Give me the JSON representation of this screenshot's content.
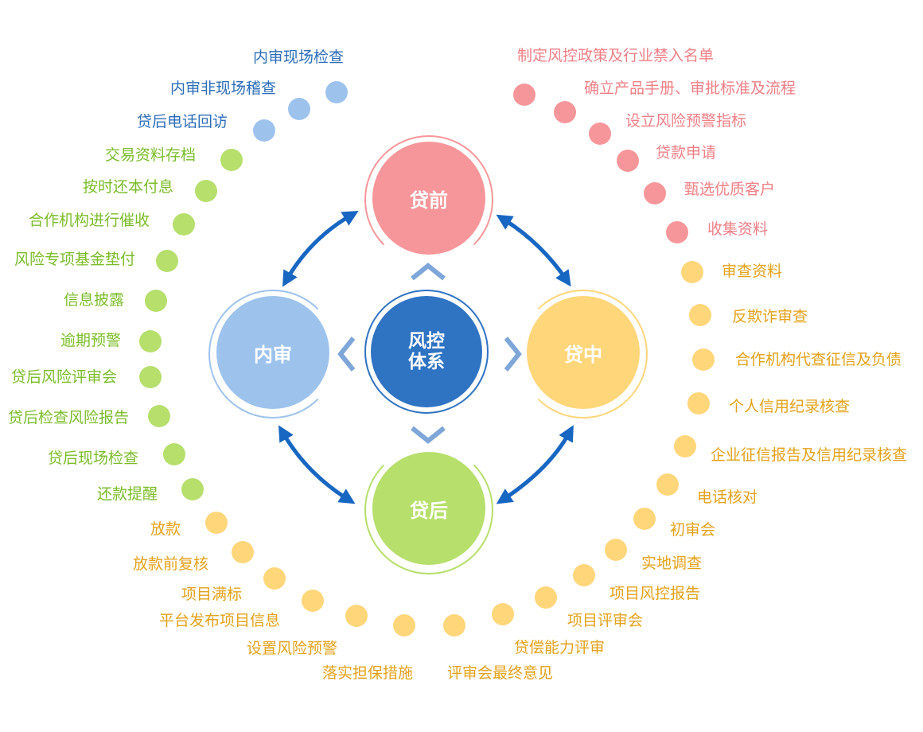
{
  "center": {
    "line1": "风控",
    "line2": "体系"
  },
  "stages": {
    "pre": {
      "label": "贷前",
      "color": "#f7969a"
    },
    "mid": {
      "label": "贷中",
      "color": "#ffd67a"
    },
    "post": {
      "label": "贷后",
      "color": "#b6df6c"
    },
    "audit": {
      "label": "内审",
      "color": "#9dc3ed"
    }
  },
  "colors": {
    "center": "#2f73c3",
    "arrow": "#1766c2",
    "audit_text": "#2c6db8",
    "pre_text": "#f07f86",
    "mid_text": "#e3a21a",
    "post_text": "#7cbc2b"
  },
  "audit_items": [
    "内审现场检查",
    "内审非现场稽查",
    "贷后电话回访"
  ],
  "post_items": [
    "交易资料存档",
    "按时还本付息",
    "合作机构进行催收",
    "风险专项基金垫付",
    "信息披露",
    "逾期预警",
    "贷后风险评审会",
    "贷后检查风险报告",
    "贷后现场检查",
    "还款提醒"
  ],
  "pre_items": [
    "制定风控政策及行业禁入名单",
    "确立产品手册、审批标准及流程",
    "设立风险预警指标",
    "贷款申请",
    "甄选优质客户",
    "收集资料"
  ],
  "mid_items_right": [
    "审查资料",
    "反欺诈审查",
    "合作机构代查征信及负债",
    "个人信用纪录核查",
    "企业征信报告及信用纪录核查",
    "电话核对",
    "初审会",
    "实地调查",
    "项目风控报告",
    "项目评审会",
    "贷偿能力评审",
    "评审会最终意见"
  ],
  "mid_items_left": [
    "放款",
    "放款前复核",
    "项目满标",
    "平台发布项目信息",
    "设置风险预警",
    "落实担保措施"
  ]
}
